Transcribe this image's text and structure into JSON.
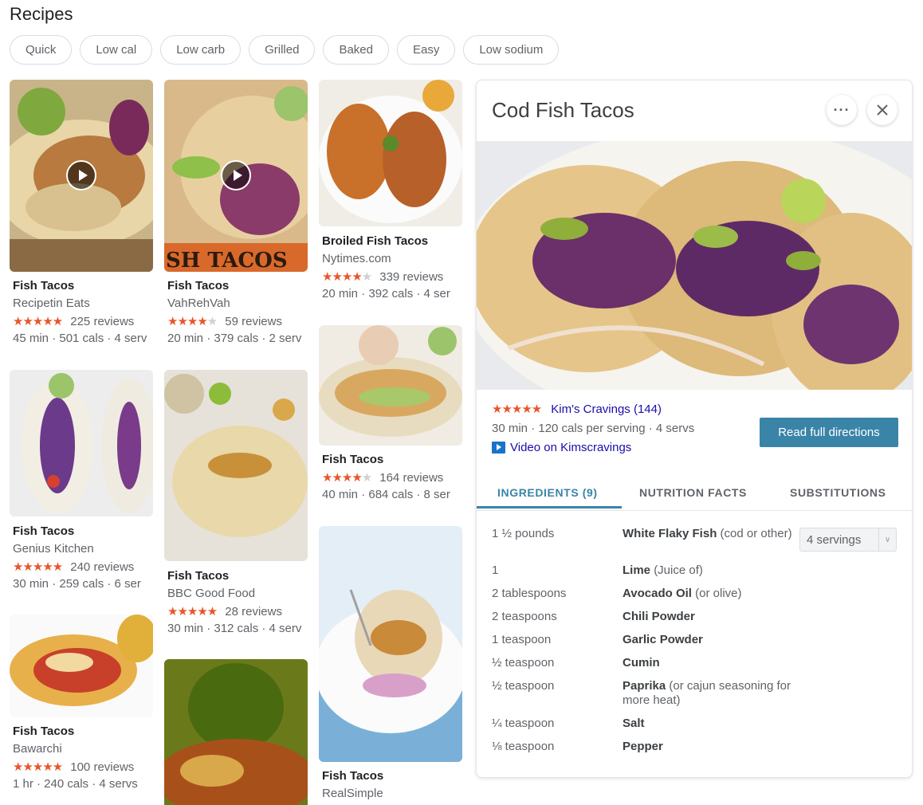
{
  "page": {
    "title": "Recipes"
  },
  "chips": [
    "Quick",
    "Low cal",
    "Low carb",
    "Grilled",
    "Baked",
    "Easy",
    "Low sodium"
  ],
  "cards": [
    {
      "title": "Fish Tacos",
      "source": "Recipetin Eats",
      "rating": 5,
      "reviews": "225 reviews",
      "meta": "45 min · 501 cals · 4 serv",
      "video": true
    },
    {
      "title": "Fish Tacos",
      "source": "Genius Kitchen",
      "rating": 5,
      "reviews": "240 reviews",
      "meta": "30 min · 259 cals · 6 ser"
    },
    {
      "title": "Fish Tacos",
      "source": "Bawarchi",
      "rating": 5,
      "reviews": "100 reviews",
      "meta": "1 hr · 240 cals · 4 servs"
    },
    {
      "title": "Fish Tacos",
      "source": "VahRehVah",
      "rating": 3.5,
      "reviews": "59 reviews",
      "meta": "20 min · 379 cals · 2 serv",
      "video": true,
      "overlay_text": "SH TACOS"
    },
    {
      "title": "Fish Tacos",
      "source": "BBC Good Food",
      "rating": 5,
      "reviews": "28 reviews",
      "meta": "30 min · 312 cals · 4 serv"
    },
    {
      "title": "Broiled Fish Tacos",
      "source": "Nytimes.com",
      "rating": 4,
      "reviews": "339 reviews",
      "meta": "20 min · 392 cals · 4 ser"
    },
    {
      "title": "Fish Tacos",
      "source": "",
      "rating": 4,
      "reviews": "164 reviews",
      "meta": "40 min · 684 cals · 8 ser"
    },
    {
      "title": "Fish Tacos",
      "source": "RealSimple"
    }
  ],
  "detail": {
    "title": "Cod Fish Tacos",
    "rating": 4.5,
    "source_link": "Kim's Cravings (144)",
    "meta": "30 min · 120 cals per serving · 4 servs",
    "video_link": "Video on Kimscravings",
    "read_button": "Read full directions",
    "tabs": [
      "INGREDIENTS (9)",
      "NUTRITION FACTS",
      "SUBSTITUTIONS"
    ],
    "servings": "4 servings",
    "ingredients": [
      {
        "qty": "1 ½ pounds",
        "name": "White Flaky Fish",
        "note": "(cod or other)"
      },
      {
        "qty": "1",
        "name": "Lime",
        "note": "(Juice of)"
      },
      {
        "qty": "2 tablespoons",
        "name": "Avocado Oil",
        "note": "(or olive)"
      },
      {
        "qty": "2 teaspoons",
        "name": "Chili Powder",
        "note": ""
      },
      {
        "qty": "1 teaspoon",
        "name": "Garlic Powder",
        "note": ""
      },
      {
        "qty": "½ teaspoon",
        "name": "Cumin",
        "note": ""
      },
      {
        "qty": "½ teaspoon",
        "name": "Paprika",
        "note": "(or cajun seasoning for more heat)"
      },
      {
        "qty": "¼ teaspoon",
        "name": "Salt",
        "note": ""
      },
      {
        "qty": "⅛ teaspoon",
        "name": "Pepper",
        "note": ""
      }
    ]
  },
  "colors": {
    "accent": "#3a84a8",
    "star": "#e8562a",
    "link": "#1a0dab"
  },
  "icons": [
    "play-icon",
    "more-icon",
    "close-icon",
    "video-icon",
    "chevron-down-icon"
  ]
}
